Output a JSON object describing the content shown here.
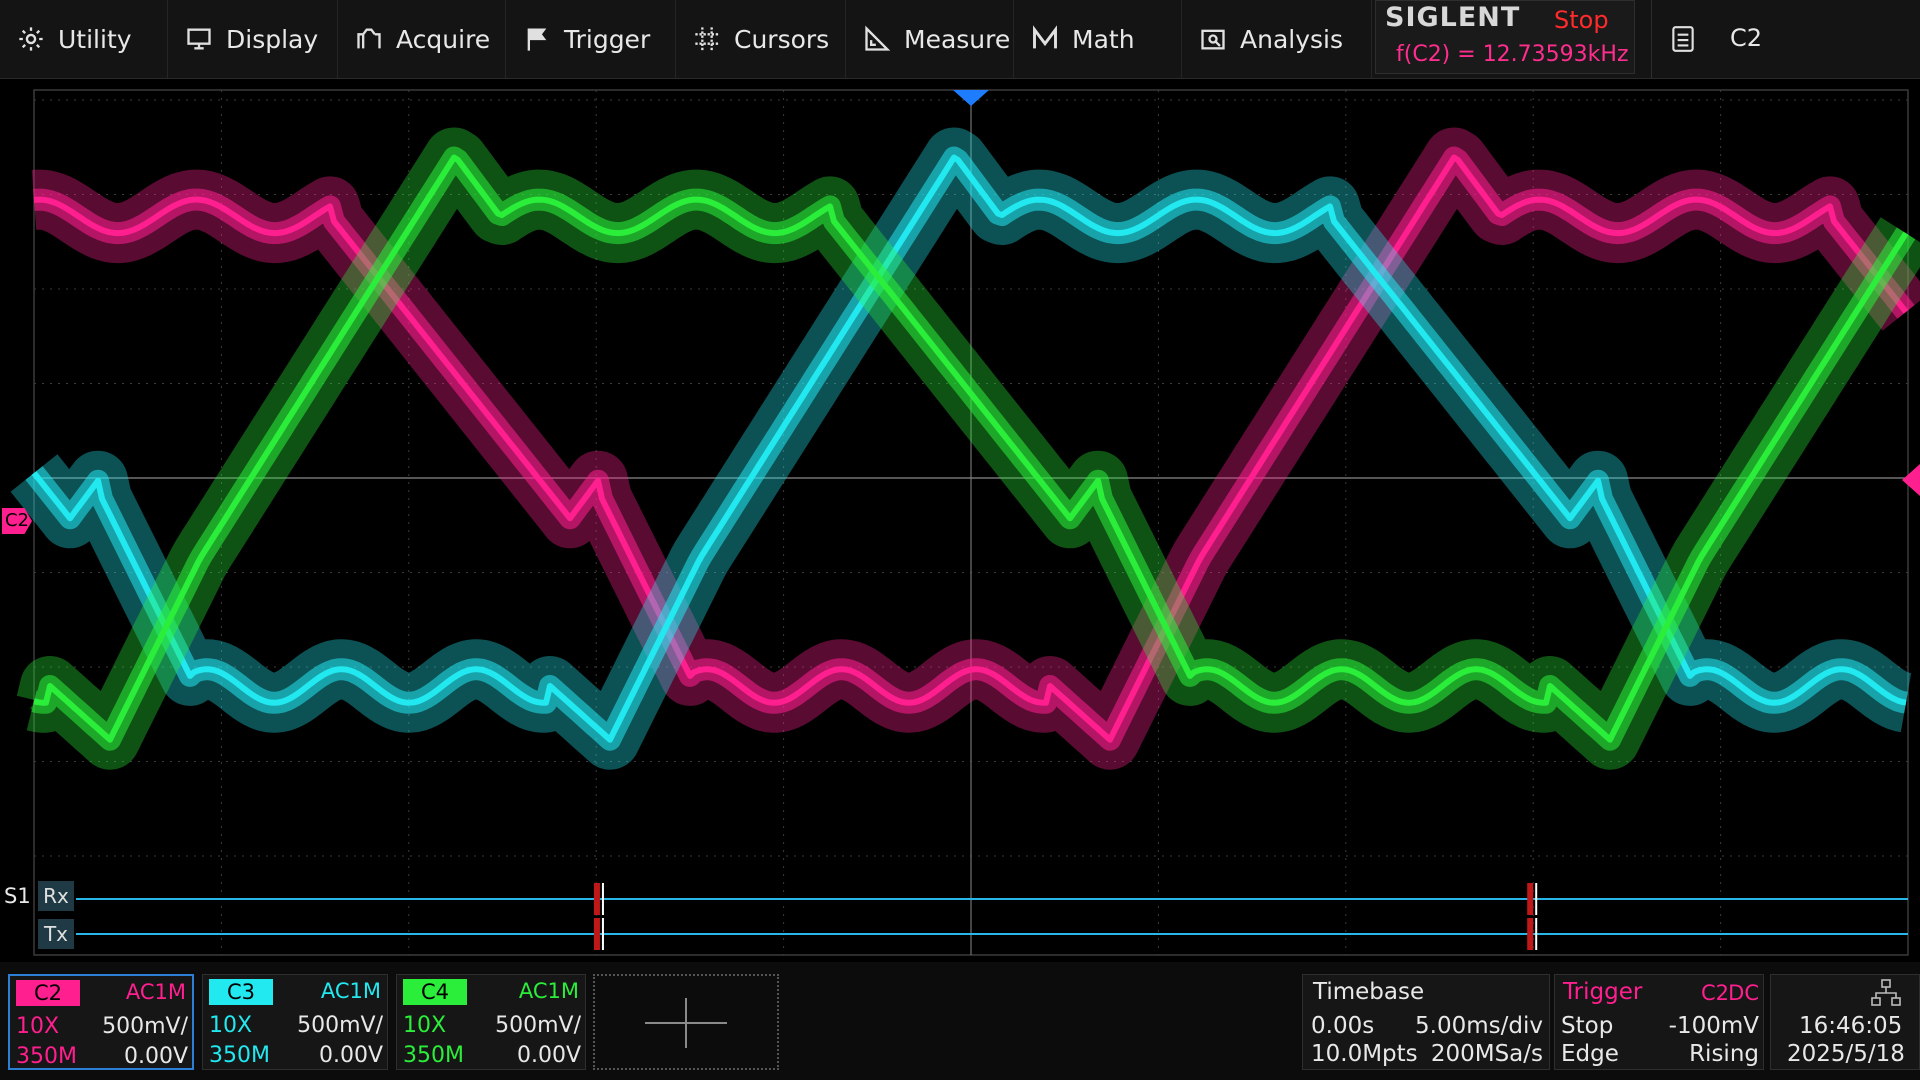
{
  "menu": {
    "items": [
      {
        "label": "Utility",
        "icon": "gear-icon"
      },
      {
        "label": "Display",
        "icon": "monitor-icon"
      },
      {
        "label": "Acquire",
        "icon": "acquire-icon"
      },
      {
        "label": "Trigger",
        "icon": "flag-icon"
      },
      {
        "label": "Cursors",
        "icon": "crosshair-icon"
      },
      {
        "label": "Measure",
        "icon": "ruler-icon"
      },
      {
        "label": "Math",
        "icon": "math-icon"
      },
      {
        "label": "Analysis",
        "icon": "analysis-icon"
      }
    ],
    "brand": "SIGLENT",
    "run_state": "Stop",
    "frequency_readout": "f(C2) = 12.73593kHz",
    "selected_channel": "C2"
  },
  "plot": {
    "channel_marker": "C2",
    "decode": {
      "bus": "S1",
      "lines": [
        "Rx",
        "Tx"
      ],
      "frame_positions_ms": [
        -9.9,
        15.0
      ]
    }
  },
  "channels": [
    {
      "name": "C2",
      "coupling": "AC1M",
      "probe": "10X",
      "scale": "500mV/",
      "bandwidth": "350M",
      "offset": "0.00V",
      "color": "#ff1f8e",
      "selected": true
    },
    {
      "name": "C3",
      "coupling": "AC1M",
      "probe": "10X",
      "scale": "500mV/",
      "bandwidth": "350M",
      "offset": "0.00V",
      "color": "#22e8f0",
      "selected": false
    },
    {
      "name": "C4",
      "coupling": "AC1M",
      "probe": "10X",
      "scale": "500mV/",
      "bandwidth": "350M",
      "offset": "0.00V",
      "color": "#2aee3a",
      "selected": false
    }
  ],
  "timebase": {
    "title": "Timebase",
    "delay": "0.00s",
    "scale": "5.00ms/div",
    "memory_depth": "10.0Mpts",
    "sample_rate": "200MSa/s"
  },
  "trigger": {
    "title": "Trigger",
    "source": "C2",
    "coupling": "DC",
    "mode": "Stop",
    "level": "-100mV",
    "type": "Edge",
    "slope": "Rising"
  },
  "clock": {
    "time": "16:46:05",
    "date": "2025/5/18",
    "network_icon": "network-icon"
  },
  "colors": {
    "c2": "#ff1f8e",
    "c3": "#22e8f0",
    "c4": "#2aee3a",
    "decode": "#29b6e8",
    "trigger_marker": "#1e7cff"
  }
}
